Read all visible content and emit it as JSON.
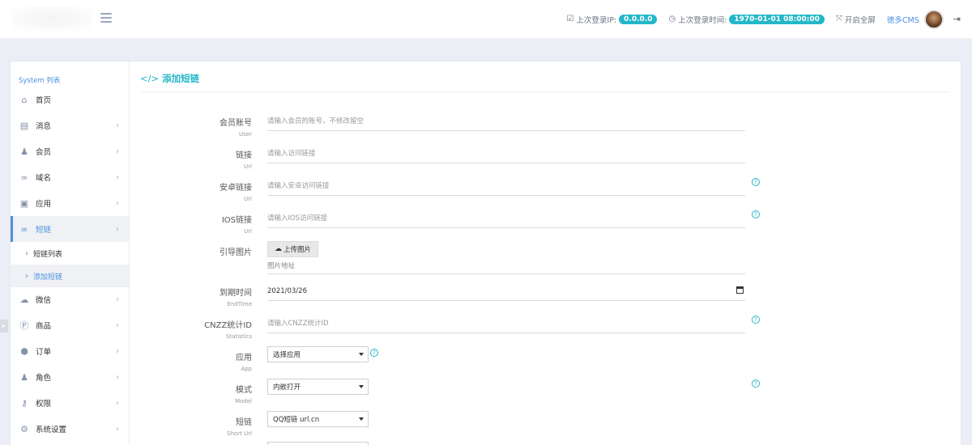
{
  "header": {
    "last_login_ip_label": "上次登录IP:",
    "last_login_ip": "0.0.0.0",
    "last_login_time_label": "上次登录时间:",
    "last_login_time": "1970-01-01 08:00:00",
    "fullscreen_label": "开启全屏",
    "more_cms_label": "徳多CMS",
    "icons": [
      "menu-toggle-icon",
      "checkbox-icon",
      "clock-icon",
      "expand-icon",
      "avatar",
      "logout-icon"
    ]
  },
  "sidebar": {
    "title": "System 列表",
    "items": [
      {
        "label": "首页",
        "icon": "home-icon"
      },
      {
        "label": "消息",
        "icon": "file-icon"
      },
      {
        "label": "会员",
        "icon": "user-icon"
      },
      {
        "label": "域名",
        "icon": "link-icon"
      },
      {
        "label": "应用",
        "icon": "gift-icon"
      },
      {
        "label": "短链",
        "icon": "link-icon"
      },
      {
        "label": "微信",
        "icon": "wechat-icon"
      },
      {
        "label": "商品",
        "icon": "product-icon"
      },
      {
        "label": "订单",
        "icon": "order-icon"
      },
      {
        "label": "角色",
        "icon": "user-icon"
      },
      {
        "label": "权限",
        "icon": "key-icon"
      },
      {
        "label": "系统设置",
        "icon": "gear-icon"
      }
    ],
    "subitems": [
      {
        "label": "短链列表"
      },
      {
        "label": "添加短链"
      }
    ]
  },
  "page": {
    "title": "添加短链"
  },
  "form": {
    "user": {
      "label": "会员账号",
      "sub": "User",
      "placeholder": "请输入会员的账号，不修改留空"
    },
    "url": {
      "label": "链接",
      "sub": "Url",
      "placeholder": "请输入访问链接"
    },
    "android_url": {
      "label": "安卓链接",
      "sub": "Url",
      "placeholder": "请输入安卓访问链接"
    },
    "ios_url": {
      "label": "IOS链接",
      "sub": "Url",
      "placeholder": "请输入IOS访问链接"
    },
    "guide_image": {
      "label": "引导图片",
      "upload_label": "上传图片",
      "address_label": "图片地址"
    },
    "end_time": {
      "label": "到期时间",
      "sub": "EndTime",
      "value": "2021/03/26"
    },
    "cnzz": {
      "label": "CNZZ统计ID",
      "sub": "Statistics",
      "placeholder": "请输入CNZZ统计ID"
    },
    "app": {
      "label": "应用",
      "sub": "App",
      "value": "选择应用"
    },
    "model": {
      "label": "模式",
      "sub": "Model",
      "value": "内嵌打开"
    },
    "short_url": {
      "label": "短链",
      "sub": "Short Url",
      "value": "QQ短链 url.cn"
    }
  },
  "colors": {
    "accent": "#23b7c8",
    "link": "#4a90e2",
    "background": "#eceef5"
  }
}
